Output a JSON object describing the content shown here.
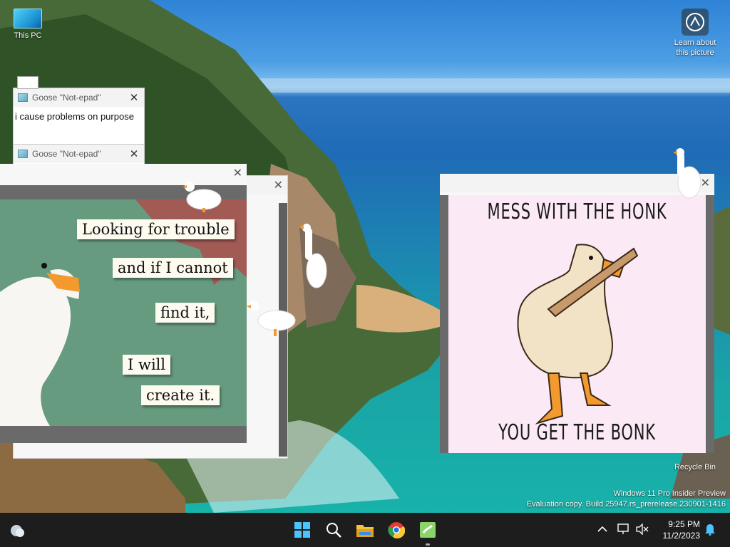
{
  "desktop": {
    "icons": [
      {
        "label": "This PC"
      },
      {
        "label": "Learn about this picture"
      },
      {
        "label": "Recycle Bin"
      }
    ],
    "watermark": {
      "line1": "Windows 11 Pro Insider Preview",
      "line2": "Evaluation copy. Build 25947.rs_prerelease.230901-1416"
    }
  },
  "notepads": [
    {
      "title": "Goose \"Not-epad\"",
      "text": "i cause problems on purpose"
    },
    {
      "title": "Goose \"Not-epad\"",
      "text": ""
    }
  ],
  "meme_trouble": {
    "lines": [
      "Looking for trouble",
      "and if I cannot",
      "find it,",
      "I will",
      "create it."
    ]
  },
  "meme_honk": {
    "top": "MESS WITH THE HONK",
    "bottom": "YOU GET THE BONK"
  },
  "taskbar": {
    "apps": [
      "start-button",
      "search-button",
      "file-explorer",
      "chrome",
      "desktop-goose"
    ],
    "time": "9:25 PM",
    "date": "11/2/2023"
  },
  "colors": {
    "taskbar": "#1d1d1d",
    "meme_trouble_bg": "#679b80",
    "meme_honk_bg": "#fbe9f5",
    "goose_beak": "#f39a2e"
  }
}
